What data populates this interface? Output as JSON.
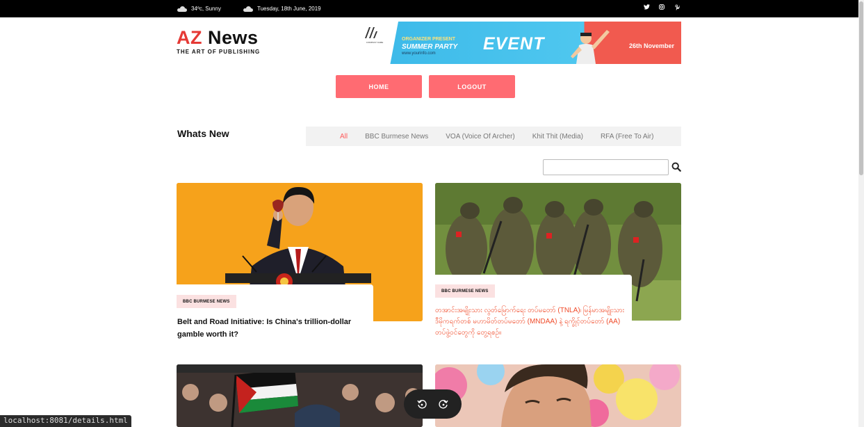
{
  "topbar": {
    "weather": "34ºc, Sunny",
    "date": "Tuesday, 18th June, 2019",
    "social_icons": [
      "twitter-icon",
      "instagram-icon",
      "pinterest-icon"
    ]
  },
  "logo": {
    "az": "AZ",
    "news": "News",
    "tagline": "THE ART OF PUBLISHING"
  },
  "banner": {
    "organizer": "ORGANIZER PRESENT",
    "summer": "SUMMER PARTY",
    "url": "www.yourinfo.com",
    "event": "EVENT",
    "date": "26th November",
    "company": "COMPANY NAME"
  },
  "nav": {
    "home": "HOME",
    "logout": "LOGOUT"
  },
  "section": {
    "title": "Whats New",
    "tabs": [
      "All",
      "BBC Burmese News",
      "VOA (Voice Of Archer)",
      "Khit Thit (Media)",
      "RFA (Free To Air)"
    ]
  },
  "search": {
    "placeholder": ""
  },
  "cards": [
    {
      "badge": "BBC BURMESE NEWS",
      "headline": "Belt and Road Initiative: Is China's trillion-dollar gamble worth it?"
    },
    {
      "badge": "BBC BURMESE NEWS",
      "headline": "တအာင်းအမျိုးသား လွတ်မြောက်ရေး တပ်မတော် (TNLA)၊ မြန်မာအမျိုးသား ဒီမိုကရက်တစ် မဟာမိတ်တပ်မတော် (MNDAA) နဲ့ ရက္ခိုင့်တပ်တော် (AA) တပ်ဖွဲ့ဝင်တွေကို တွေ့ရစဉ်။"
    }
  ],
  "status": {
    "url": "localhost:8081/details.html"
  },
  "colors": {
    "accent": "#ff6b72",
    "brand_red": "#e53935",
    "topbar": "#000000"
  }
}
